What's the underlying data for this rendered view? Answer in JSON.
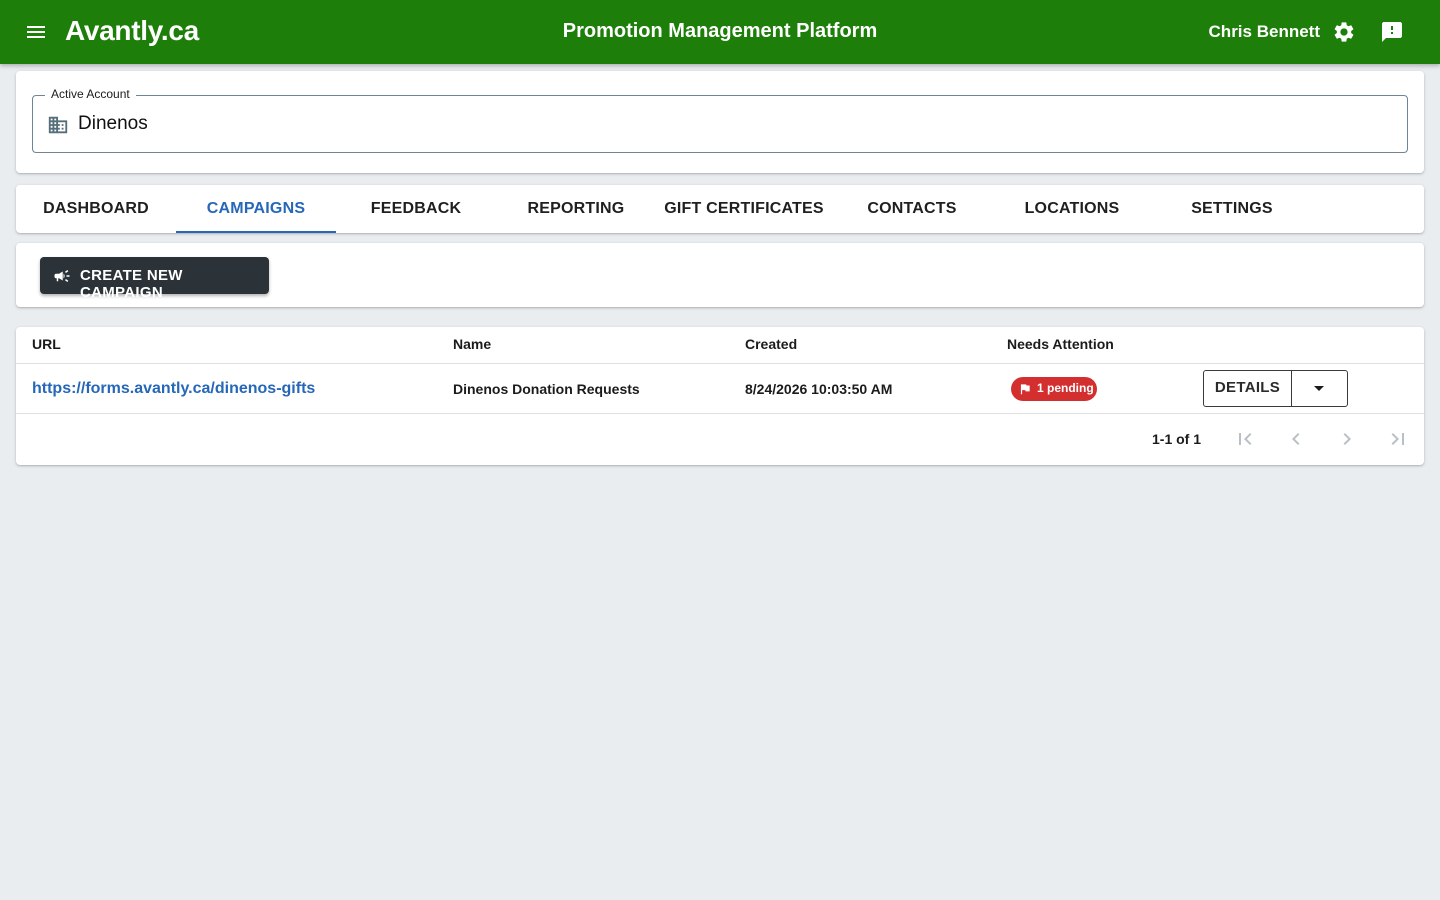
{
  "appbar": {
    "brand": "Avantly.ca",
    "title": "Promotion Management Platform",
    "user": "Chris Bennett"
  },
  "account": {
    "label": "Active Account",
    "value": "Dinenos"
  },
  "tabs": [
    {
      "label": "DASHBOARD"
    },
    {
      "label": "CAMPAIGNS",
      "active": true
    },
    {
      "label": "FEEDBACK"
    },
    {
      "label": "REPORTING"
    },
    {
      "label": "GIFT CERTIFICATES"
    },
    {
      "label": "CONTACTS"
    },
    {
      "label": "LOCATIONS"
    },
    {
      "label": "SETTINGS"
    }
  ],
  "actions": {
    "create_label": "CREATE NEW CAMPAIGN"
  },
  "table": {
    "columns": [
      "URL",
      "Name",
      "Created",
      "Needs Attention"
    ],
    "rows": [
      {
        "url": "https://forms.avantly.ca/dinenos-gifts",
        "name": "Dinenos Donation Requests",
        "created": "8/24/2026 10:03:50 AM",
        "attention": "1 pending",
        "action": "DETAILS"
      }
    ],
    "pagination": "1-1 of 1"
  },
  "colors": {
    "appbar": "#1e7e0a",
    "accent": "#2667b8",
    "badge": "#d32f2f",
    "primary_button": "#2b3338",
    "background": "#e9edf0"
  },
  "icons": [
    "menu-icon",
    "gear-icon",
    "feedback-icon",
    "building-icon",
    "megaphone-icon",
    "flag-icon",
    "caret-down-icon",
    "first-page-icon",
    "prev-page-icon",
    "next-page-icon",
    "last-page-icon"
  ]
}
